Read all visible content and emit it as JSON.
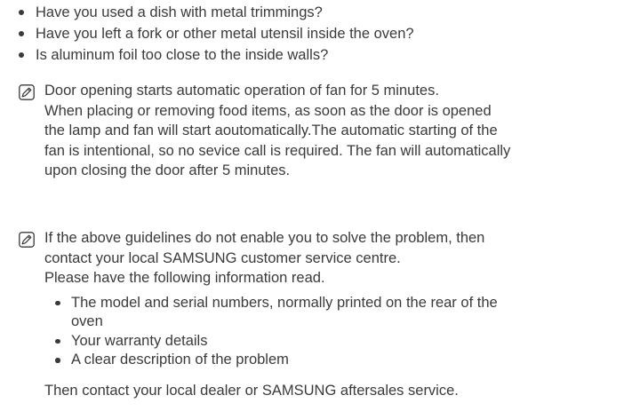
{
  "checklist": [
    "Have you used a dish with metal trimmings?",
    "Have you left a fork or other metal utensil inside the oven?",
    "Is aluminum foil too close to the inside walls?"
  ],
  "note_fan": {
    "icon": "note-pencil-icon",
    "lines": [
      "Door opening starts automatic operation of fan for 5 minutes.",
      "When placing or removing food items, as soon as the door is opened",
      "the lamp and fan will start aoutomatically.The automatic starting of the",
      "fan is intentional, so no sevice call is required. The fan will automatically",
      "upon closing the door after 5 minutes."
    ]
  },
  "note_service": {
    "icon": "note-pencil-icon",
    "lines": [
      "If the above guidelines do not enable you to solve the problem, then",
      "contact your local SAMSUNG customer service centre.",
      "Please have the following information read."
    ],
    "info_items": [
      {
        "lines": [
          "The model and serial numbers, normally printed on the rear of the",
          "oven"
        ]
      },
      {
        "lines": [
          "Your warranty details"
        ]
      },
      {
        "lines": [
          "A clear description of the problem"
        ]
      }
    ],
    "closing": "Then contact your local dealer or SAMSUNG aftersales service."
  }
}
